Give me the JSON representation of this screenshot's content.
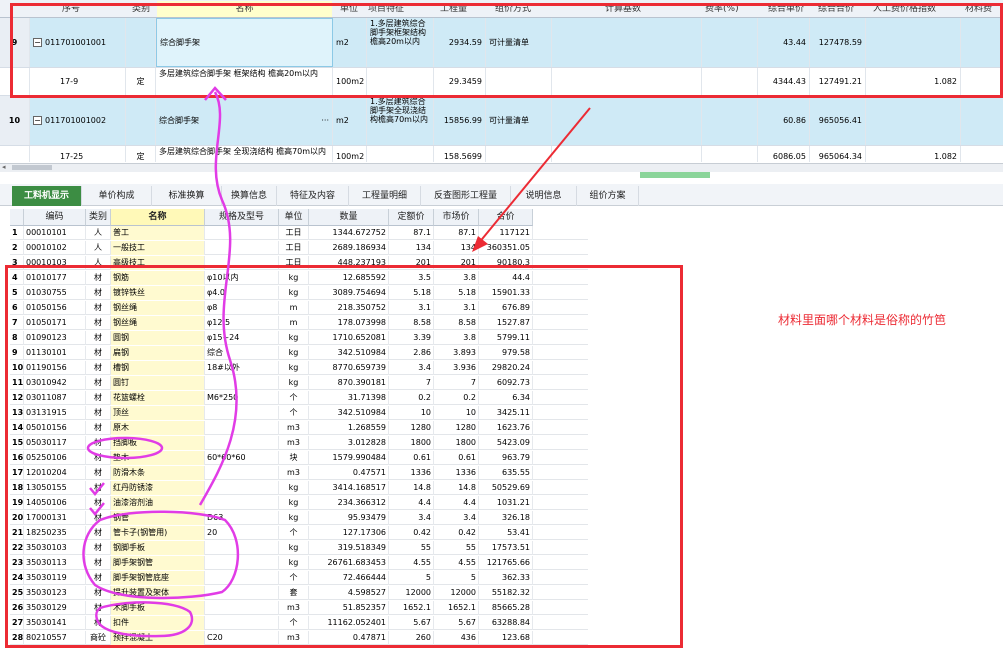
{
  "top_grid": {
    "headers": [
      "序号",
      "类别",
      "名称",
      "单位",
      "项目特征",
      "工程量",
      "组价方式",
      "计算基数",
      "费率(%)",
      "综合单价",
      "综合合价",
      "人工费价格指数",
      "材料费"
    ],
    "rows": [
      {
        "index": "9",
        "code": "011701001001",
        "type": "",
        "name": "综合脚手架",
        "unit": "m2",
        "feature": "1.多层建筑综合脚手架框架结构檐高20m以内",
        "qty": "2934.59",
        "method": "可计量清单",
        "unit_price": "43.44",
        "total": "127478.59",
        "labor_idx": ""
      },
      {
        "index": "",
        "code": "17-9",
        "type": "定",
        "name": "多层建筑综合脚手架 框架结构 檐高20m以内",
        "unit": "100m2",
        "feature": "",
        "qty": "29.3459",
        "method": "",
        "unit_price": "4344.43",
        "total": "127491.21",
        "labor_idx": "1.082"
      },
      {
        "index": "10",
        "code": "011701001002",
        "type": "",
        "name": "综合脚手架",
        "unit": "m2",
        "feature": "1.多层建筑综合脚手架全现浇结构檐高70m以内",
        "qty": "15856.99",
        "method": "可计量清单",
        "unit_price": "60.86",
        "total": "965056.41",
        "labor_idx": ""
      },
      {
        "index": "",
        "code": "17-25",
        "type": "定",
        "name": "多层建筑综合脚手架 全现浇结构 檐高70m以内",
        "unit": "100m2",
        "feature": "",
        "qty": "158.5699",
        "method": "",
        "unit_price": "6086.05",
        "total": "965064.34",
        "labor_idx": "1.082"
      }
    ],
    "ellipsis": "···"
  },
  "tabs": [
    {
      "label": "工料机显示",
      "active": true
    },
    {
      "label": "单价构成",
      "active": false
    },
    {
      "label": "标准换算",
      "active": false
    },
    {
      "label": "换算信息",
      "active": false
    },
    {
      "label": "特征及内容",
      "active": false
    },
    {
      "label": "工程量明细",
      "active": false
    },
    {
      "label": "反查图形工程量",
      "active": false
    },
    {
      "label": "说明信息",
      "active": false
    },
    {
      "label": "组价方案",
      "active": false
    }
  ],
  "resource_table": {
    "headers": [
      "",
      "编码",
      "类别",
      "名称",
      "规格及型号",
      "单位",
      "数量",
      "定额价",
      "市场价",
      "合价"
    ],
    "rows": [
      [
        "1",
        "00010101",
        "人",
        "普工",
        "",
        "工日",
        "1344.672752",
        "87.1",
        "87.1",
        "117121"
      ],
      [
        "2",
        "00010102",
        "人",
        "一般技工",
        "",
        "工日",
        "2689.186934",
        "134",
        "134",
        "360351.05"
      ],
      [
        "3",
        "00010103",
        "人",
        "高级技工",
        "",
        "工日",
        "448.237193",
        "201",
        "201",
        "90180.3"
      ],
      [
        "4",
        "01010177",
        "材",
        "钢筋",
        "φ10以内",
        "kg",
        "12.685592",
        "3.5",
        "3.8",
        "44.4"
      ],
      [
        "5",
        "01030755",
        "材",
        "镀锌铁丝",
        "φ4.0",
        "kg",
        "3089.754694",
        "5.18",
        "5.18",
        "15901.33"
      ],
      [
        "6",
        "01050156",
        "材",
        "钢丝绳",
        "φ8",
        "m",
        "218.350752",
        "3.1",
        "3.1",
        "676.89"
      ],
      [
        "7",
        "01050171",
        "材",
        "钢丝绳",
        "φ12.5",
        "m",
        "178.073998",
        "8.58",
        "8.58",
        "1527.87"
      ],
      [
        "8",
        "01090123",
        "材",
        "圆钢",
        "φ15~24",
        "kg",
        "1710.652081",
        "3.39",
        "3.8",
        "5799.11"
      ],
      [
        "9",
        "01130101",
        "材",
        "扁钢",
        "综合",
        "kg",
        "342.510984",
        "2.86",
        "3.893",
        "979.58"
      ],
      [
        "10",
        "01190156",
        "材",
        "槽钢",
        "18#以外",
        "kg",
        "8770.659739",
        "3.4",
        "3.936",
        "29820.24"
      ],
      [
        "11",
        "03010942",
        "材",
        "圆钉",
        "",
        "kg",
        "870.390181",
        "7",
        "7",
        "6092.73"
      ],
      [
        "12",
        "03011087",
        "材",
        "花篮螺栓",
        "M6*250",
        "个",
        "31.71398",
        "0.2",
        "0.2",
        "6.34"
      ],
      [
        "13",
        "03131915",
        "材",
        "顶丝",
        "",
        "个",
        "342.510984",
        "10",
        "10",
        "3425.11"
      ],
      [
        "14",
        "05010156",
        "材",
        "原木",
        "",
        "m3",
        "1.268559",
        "1280",
        "1280",
        "1623.76"
      ],
      [
        "15",
        "05030117",
        "材",
        "挡脚板",
        "",
        "m3",
        "3.012828",
        "1800",
        "1800",
        "5423.09"
      ],
      [
        "16",
        "05250106",
        "材",
        "垫木",
        "60*60*60",
        "块",
        "1579.990484",
        "0.61",
        "0.61",
        "963.79"
      ],
      [
        "17",
        "12010204",
        "材",
        "防滑木条",
        "",
        "m3",
        "0.47571",
        "1336",
        "1336",
        "635.55"
      ],
      [
        "18",
        "13050155",
        "材",
        "红丹防锈漆",
        "",
        "kg",
        "3414.168517",
        "14.8",
        "14.8",
        "50529.69"
      ],
      [
        "19",
        "14050106",
        "材",
        "油漆溶剂油",
        "",
        "kg",
        "234.366312",
        "4.4",
        "4.4",
        "1031.21"
      ],
      [
        "20",
        "17000131",
        "材",
        "钢管",
        "D63",
        "kg",
        "95.93479",
        "3.4",
        "3.4",
        "326.18"
      ],
      [
        "21",
        "18250235",
        "材",
        "管卡子(钢管用)",
        "20",
        "个",
        "127.17306",
        "0.42",
        "0.42",
        "53.41"
      ],
      [
        "22",
        "35030103",
        "材",
        "钢脚手板",
        "",
        "kg",
        "319.518349",
        "55",
        "55",
        "17573.51"
      ],
      [
        "23",
        "35030113",
        "材",
        "脚手架钢管",
        "",
        "kg",
        "26761.683453",
        "4.55",
        "4.55",
        "121765.66"
      ],
      [
        "24",
        "35030119",
        "材",
        "脚手架钢管底座",
        "",
        "个",
        "72.466444",
        "5",
        "5",
        "362.33"
      ],
      [
        "25",
        "35030123",
        "材",
        "提升装置及架体",
        "",
        "套",
        "4.598527",
        "12000",
        "12000",
        "55182.32"
      ],
      [
        "26",
        "35030129",
        "材",
        "木脚手板",
        "",
        "m3",
        "51.852357",
        "1652.1",
        "1652.1",
        "85665.28"
      ],
      [
        "27",
        "35030141",
        "材",
        "扣件",
        "",
        "个",
        "11162.052401",
        "5.67",
        "5.67",
        "63288.84"
      ],
      [
        "28",
        "80210557",
        "商砼",
        "预拌混凝土",
        "C20",
        "m3",
        "0.47871",
        "260",
        "436",
        "123.68"
      ]
    ]
  },
  "annotation": {
    "question": "材料里面哪个材料是俗称的竹笆",
    "colors": {
      "red": "#ec2b34",
      "magenta": "#e13ce6",
      "tab_green": "#3c8d43"
    }
  }
}
